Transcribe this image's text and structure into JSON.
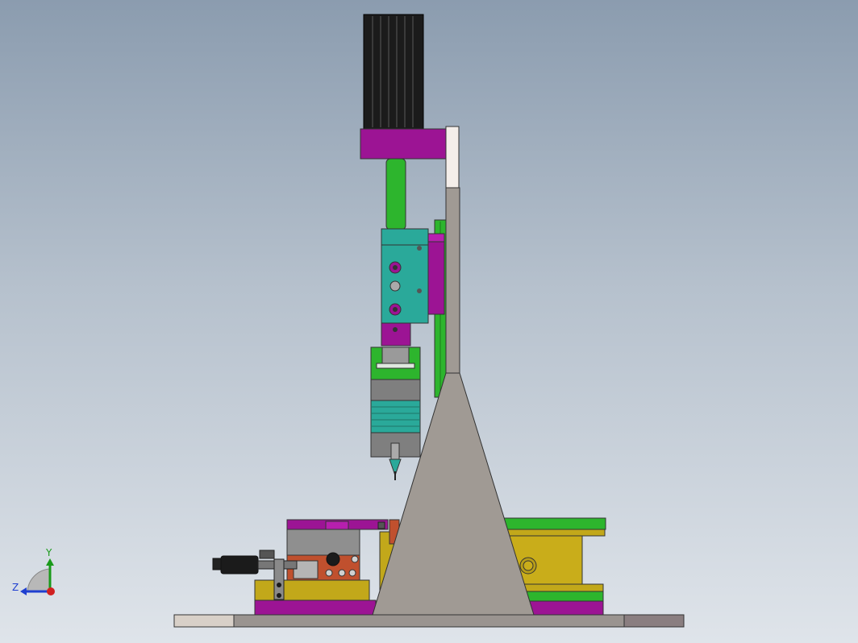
{
  "triad": {
    "y_label": "Y",
    "z_label": "Z"
  },
  "colors": {
    "background_top": "#8b9caf",
    "background_bottom": "#dfe4ea",
    "motor": "#1b1b1b",
    "magenta": "#9c1494",
    "green": "#2db52d",
    "teal": "#2aa99a",
    "grey_plate": "#a09a94",
    "yellow": "#c2a81a",
    "orange_red": "#c0502e",
    "base": "#9a9490"
  }
}
